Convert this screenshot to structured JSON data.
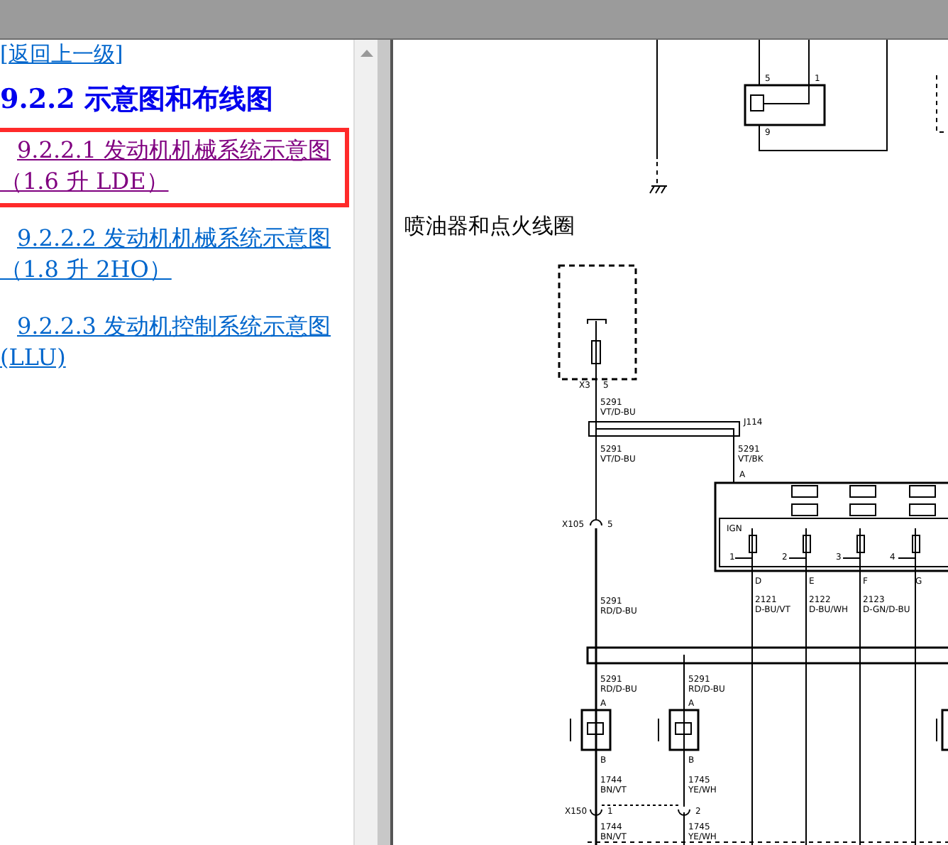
{
  "back_link": "[返回上一级]",
  "heading": "9.2.2 示意图和布线图",
  "items": [
    {
      "label": "9.2.2.1 发动机机械系统示意图（1.6 升 LDE）",
      "selected": true
    },
    {
      "label": "9.2.2.2 发动机机械系统示意图（1.8 升 2HO）",
      "selected": false
    },
    {
      "label": "9.2.2.3 发动机控制系统示意图 (LLU)",
      "selected": false
    }
  ],
  "diagram": {
    "section_title": "喷油器和点火线圈",
    "labels": [
      "5",
      "1",
      "9",
      "X3",
      "5",
      "5291",
      "VT/D-BU",
      "J114",
      "5291",
      "VT/D-BU",
      "5291",
      "VT/BK",
      "A",
      "X105",
      "5",
      "IGN",
      "1",
      "2",
      "3",
      "4",
      "D",
      "E",
      "F",
      "G",
      "2121",
      "D-BU/VT",
      "2122",
      "D-BU/WH",
      "2123",
      "D-GN/D-BU",
      "5291",
      "RD/D-BU",
      "5291",
      "RD/D-BU",
      "5291",
      "RD/D-BU",
      "A",
      "A",
      "B",
      "B",
      "1744",
      "BN/VT",
      "1745",
      "YE/WH",
      "X150",
      "1",
      "2",
      "1744",
      "BN/VT",
      "1745",
      "YE/WH"
    ]
  }
}
